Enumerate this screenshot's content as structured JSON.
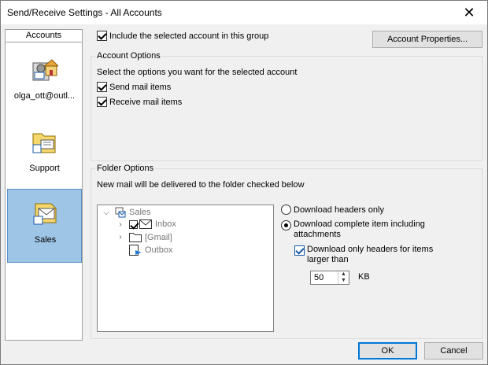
{
  "window": {
    "title": "Send/Receive Settings - All Accounts"
  },
  "sidebar": {
    "header": "Accounts",
    "accounts": [
      {
        "label": "olga_ott@outl...",
        "icon": "account-house-icon",
        "selected": false
      },
      {
        "label": "Support",
        "icon": "folder-account-icon",
        "selected": false
      },
      {
        "label": "Sales",
        "icon": "envelope-account-icon",
        "selected": true
      }
    ]
  },
  "include_account": {
    "label": "Include the selected account in this group",
    "checked": true
  },
  "account_properties_button": "Account Properties...",
  "account_options": {
    "title": "Account Options",
    "description": "Select the options you want for the selected account",
    "send_mail": {
      "label": "Send mail items",
      "checked": true
    },
    "receive_mail": {
      "label": "Receive mail items",
      "checked": true
    }
  },
  "folder_options": {
    "title": "Folder Options",
    "description": "New mail will be delivered to the folder checked below",
    "tree": {
      "root": "Sales",
      "items": [
        {
          "label": "Inbox",
          "checked": true,
          "expandable": true
        },
        {
          "label": "[Gmail]",
          "checked": false,
          "expandable": true
        },
        {
          "label": "Outbox",
          "checked": false,
          "expandable": false
        }
      ]
    },
    "download_headers_only": {
      "label": "Download headers only",
      "selected": false
    },
    "download_complete": {
      "label_line1": "Download complete item including",
      "label_line2": "attachments",
      "selected": true
    },
    "download_only_headers_larger": {
      "label_line1": "Download only headers for items",
      "label_line2": "larger than",
      "checked": true
    },
    "size_value": "50",
    "size_unit": "KB"
  },
  "footer": {
    "ok": "OK",
    "cancel": "Cancel"
  },
  "colors": {
    "selection": "#9ec4e6",
    "accent": "#0078d7",
    "window_bg": "#f0f0f0"
  }
}
